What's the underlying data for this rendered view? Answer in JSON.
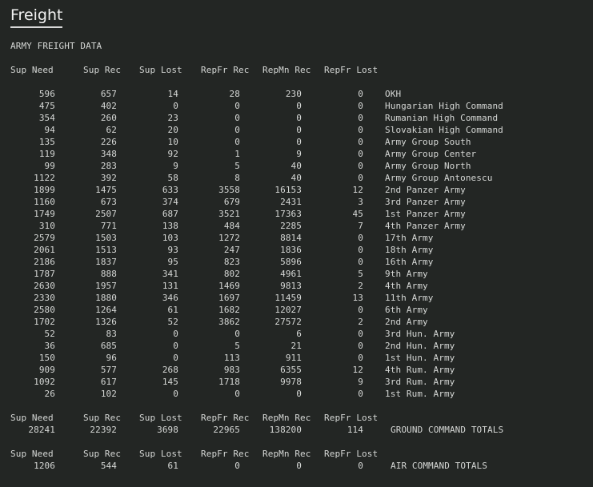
{
  "title": "Freight",
  "section_title": "ARMY FREIGHT DATA",
  "headers": [
    "Sup Need",
    "Sup Rec",
    "Sup Lost",
    "RepFr Rec",
    "RepMn Rec",
    "RepFr Lost"
  ],
  "rows": [
    [
      "596",
      "657",
      "14",
      "28",
      "230",
      "0",
      "OKH"
    ],
    [
      "475",
      "402",
      "0",
      "0",
      "0",
      "0",
      "Hungarian High Command"
    ],
    [
      "354",
      "260",
      "23",
      "0",
      "0",
      "0",
      "Rumanian High Command"
    ],
    [
      "94",
      "62",
      "20",
      "0",
      "0",
      "0",
      "Slovakian High Command"
    ],
    [
      "135",
      "226",
      "10",
      "0",
      "0",
      "0",
      "Army Group South"
    ],
    [
      "119",
      "348",
      "92",
      "1",
      "9",
      "0",
      "Army Group Center"
    ],
    [
      "99",
      "283",
      "9",
      "5",
      "40",
      "0",
      "Army Group North"
    ],
    [
      "1122",
      "392",
      "58",
      "8",
      "40",
      "0",
      "Army Group Antonescu"
    ],
    [
      "1899",
      "1475",
      "633",
      "3558",
      "16153",
      "12",
      "2nd Panzer Army"
    ],
    [
      "1160",
      "673",
      "374",
      "679",
      "2431",
      "3",
      "3rd Panzer Army"
    ],
    [
      "1749",
      "2507",
      "687",
      "3521",
      "17363",
      "45",
      "1st Panzer Army"
    ],
    [
      "310",
      "771",
      "138",
      "484",
      "2285",
      "7",
      "4th Panzer Army"
    ],
    [
      "2579",
      "1503",
      "103",
      "1272",
      "8814",
      "0",
      "17th Army"
    ],
    [
      "2061",
      "1513",
      "93",
      "247",
      "1836",
      "0",
      "18th Army"
    ],
    [
      "2186",
      "1837",
      "95",
      "823",
      "5896",
      "0",
      "16th Army"
    ],
    [
      "1787",
      "888",
      "341",
      "802",
      "4961",
      "5",
      "9th Army"
    ],
    [
      "2630",
      "1957",
      "131",
      "1469",
      "9813",
      "2",
      "4th Army"
    ],
    [
      "2330",
      "1880",
      "346",
      "1697",
      "11459",
      "13",
      "11th Army"
    ],
    [
      "2580",
      "1264",
      "61",
      "1682",
      "12027",
      "0",
      "6th Army"
    ],
    [
      "1702",
      "1326",
      "52",
      "3862",
      "27572",
      "2",
      "2nd Army"
    ],
    [
      "52",
      "83",
      "0",
      "0",
      "6",
      "0",
      "3rd Hun. Army"
    ],
    [
      "36",
      "685",
      "0",
      "5",
      "21",
      "0",
      "2nd Hun. Army"
    ],
    [
      "150",
      "96",
      "0",
      "113",
      "911",
      "0",
      "1st Hun. Army"
    ],
    [
      "909",
      "577",
      "268",
      "983",
      "6355",
      "12",
      "4th Rum. Army"
    ],
    [
      "1092",
      "617",
      "145",
      "1718",
      "9978",
      "9",
      "3rd Rum. Army"
    ],
    [
      "26",
      "102",
      "0",
      "0",
      "0",
      "0",
      "1st Rum. Army"
    ]
  ],
  "ground_totals": {
    "values": [
      "28241",
      "22392",
      "3698",
      "22965",
      "138200",
      "114"
    ],
    "label": "GROUND COMMAND TOTALS"
  },
  "air_totals": {
    "values": [
      "1206",
      "544",
      "61",
      "0",
      "0",
      "0"
    ],
    "label": "AIR COMMAND TOTALS"
  },
  "colors": {
    "background": "#232624",
    "text": "#d6d8d6"
  }
}
